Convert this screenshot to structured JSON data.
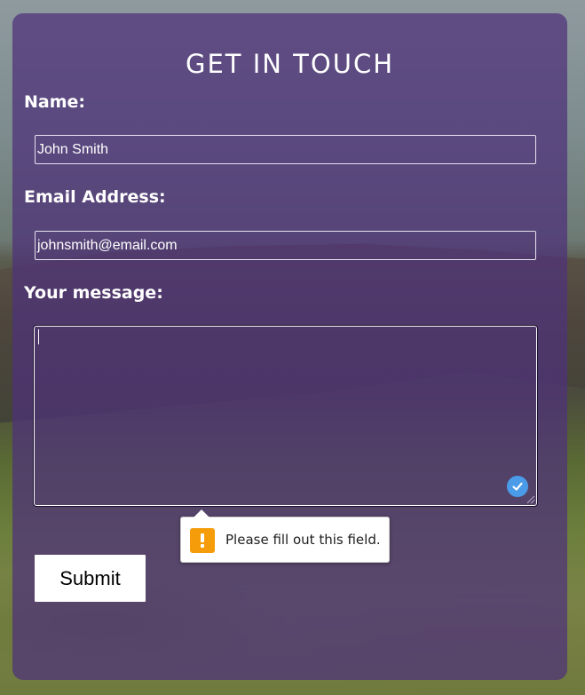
{
  "form": {
    "title": "GET IN TOUCH",
    "name_label": "Name:",
    "name_value": "John Smith",
    "email_label": "Email Address:",
    "email_value": "johnsmith@email.com",
    "message_label": "Your message:",
    "message_value": "",
    "submit_label": "Submit"
  },
  "validation": {
    "message": "Please fill out this field.",
    "icon": "warning-icon",
    "icon_color": "#f59c0a"
  },
  "colors": {
    "panel": "#4e327a",
    "check_badge": "#4a9be8"
  }
}
